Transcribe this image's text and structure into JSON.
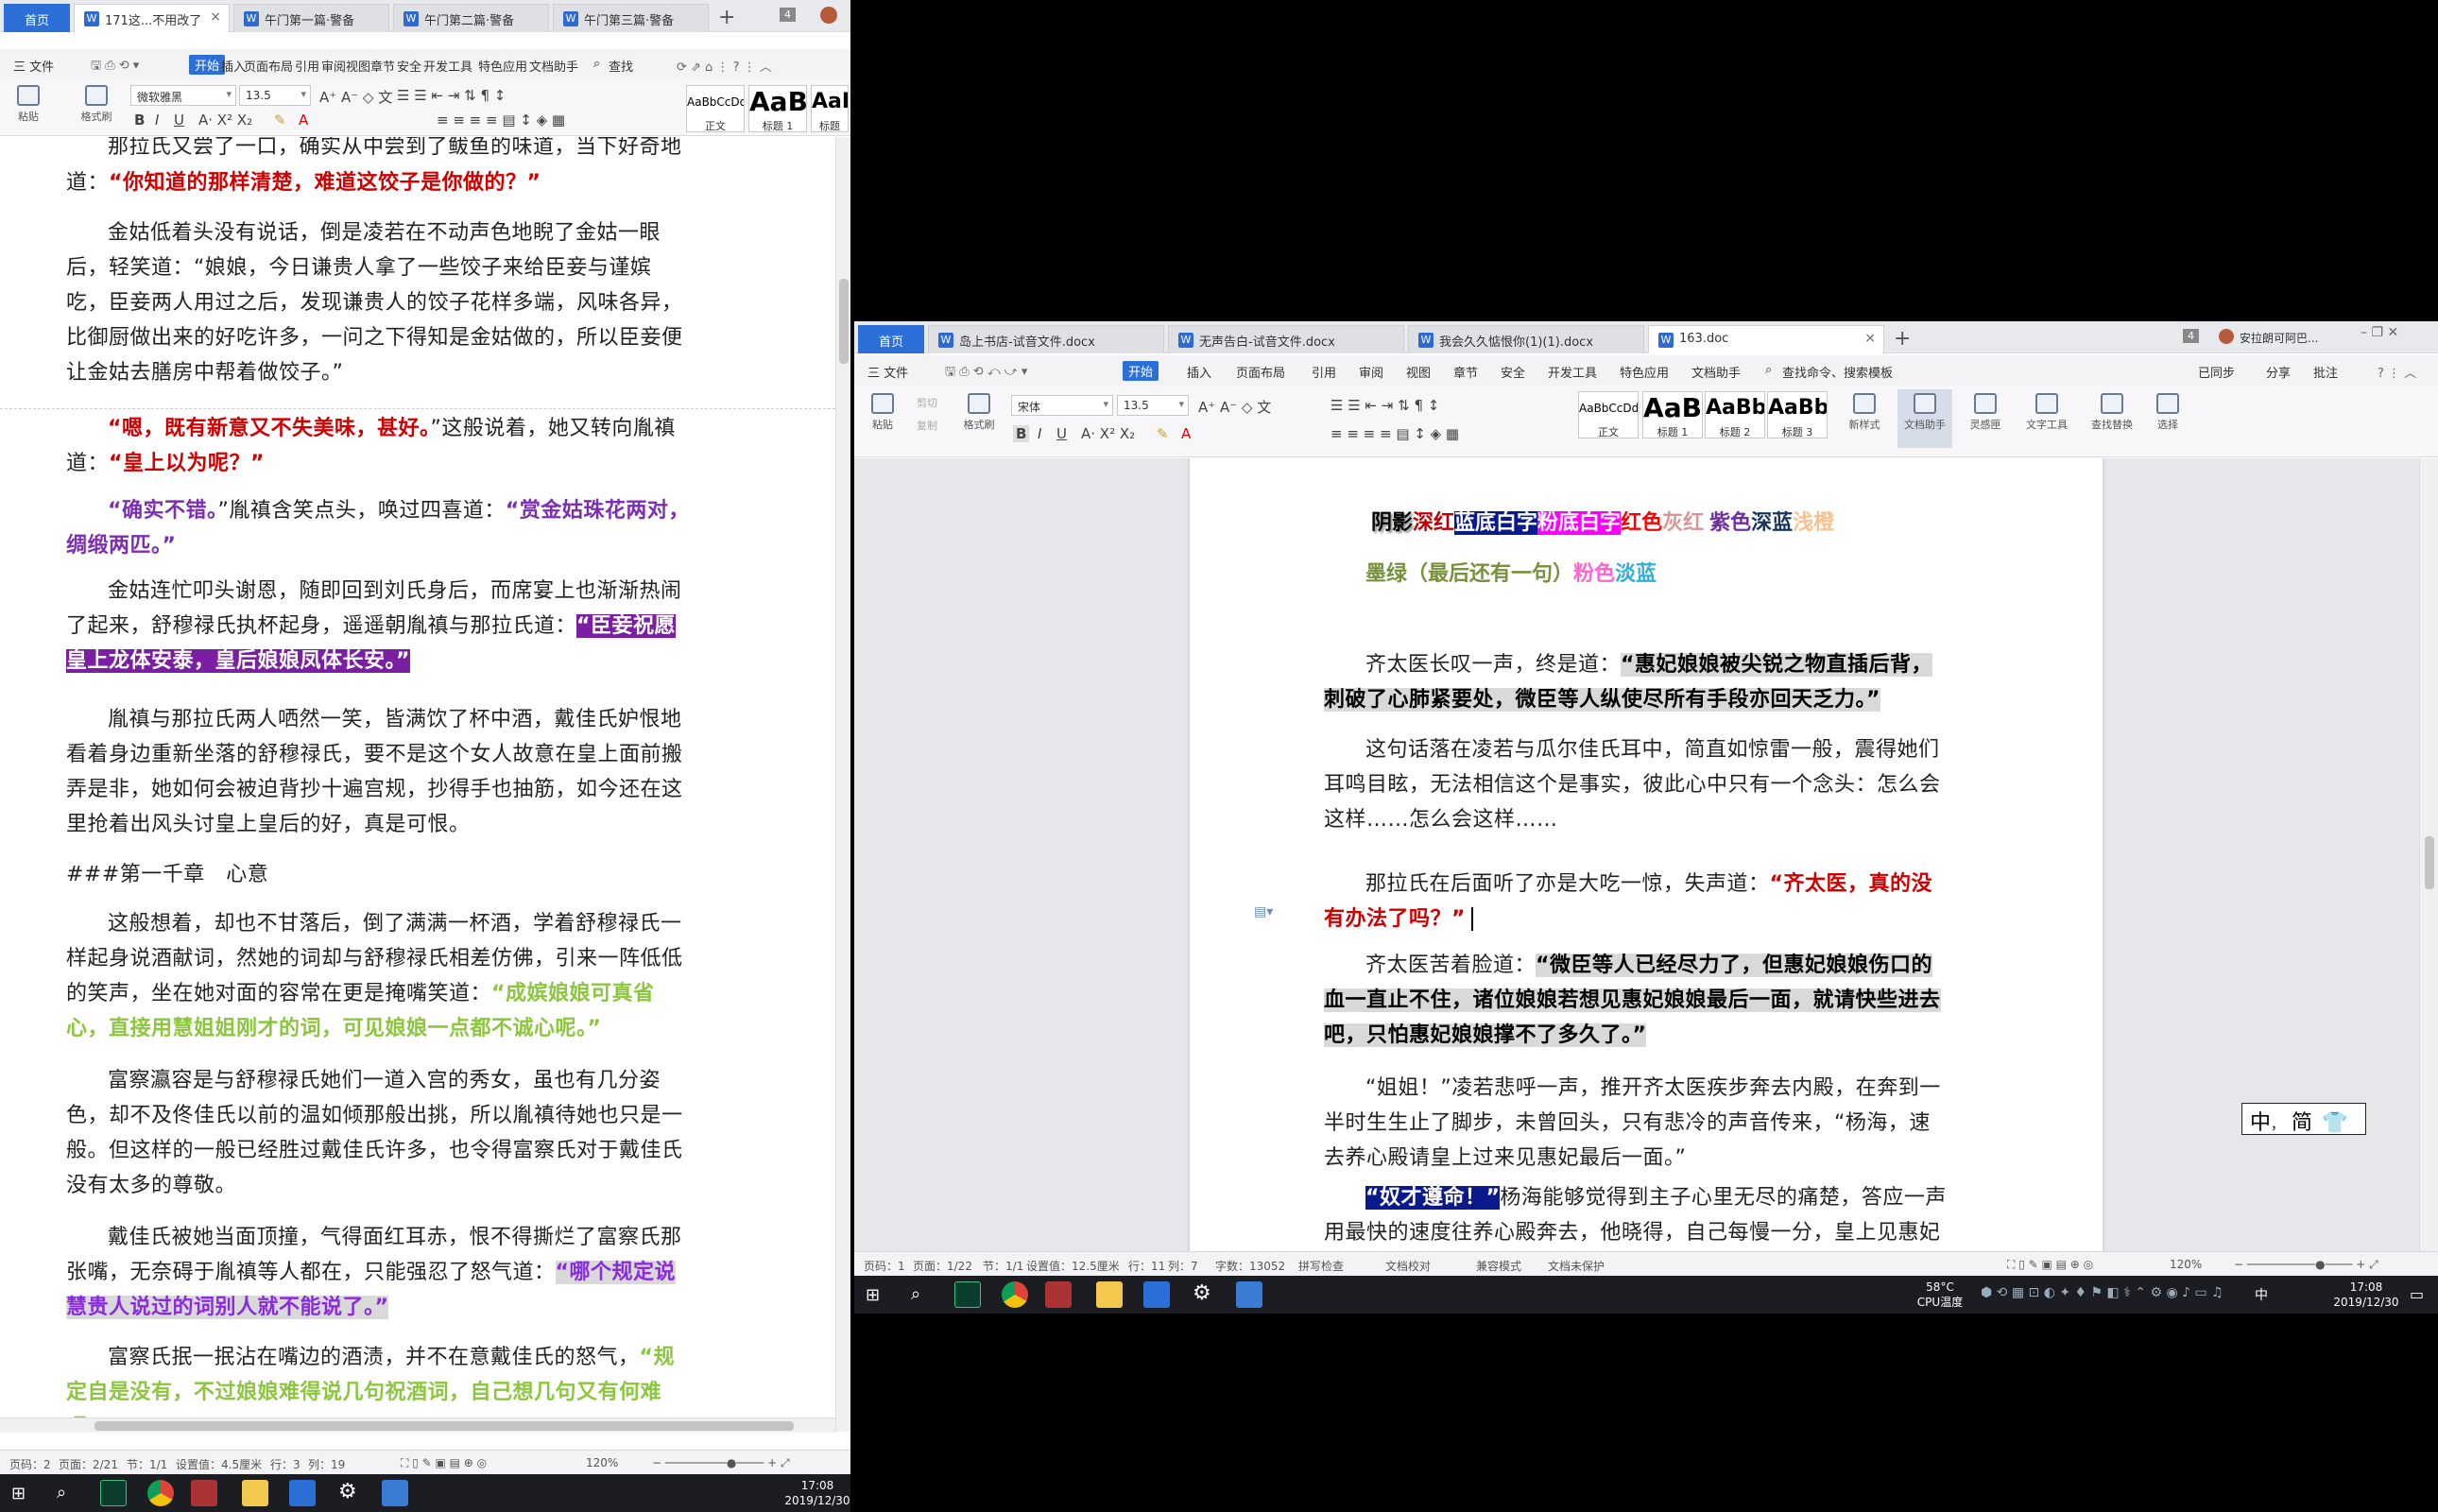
{
  "left_window": {
    "tabs": [
      {
        "label": "首页"
      },
      {
        "label": "171这...不用改了"
      },
      {
        "label": "午门第一篇·警备"
      },
      {
        "label": "午门第二篇·警备"
      },
      {
        "label": "午门第三篇·警备"
      }
    ],
    "tab_badge": "4",
    "menu": {
      "file": "三 文件",
      "items": [
        "开始",
        "插入",
        "页面布局",
        "引用",
        "审阅",
        "视图",
        "章节",
        "安全",
        "开发工具",
        "特色应用",
        "文档助手"
      ],
      "search": "查找"
    },
    "toolbar": {
      "paste": "粘贴",
      "format_painter": "格式刷",
      "font": "微软雅黑",
      "size": "13.5",
      "styles": [
        {
          "big": "AaBbCcDd",
          "label": "正文"
        },
        {
          "big": "AaB",
          "label": "标题 1"
        },
        {
          "big": "AaE",
          "label": "标题"
        }
      ]
    },
    "doc": {
      "p0a": "那拉氏又尝了一口，确实从中尝到了鲅鱼的味道，当下好奇地",
      "p0b_pre": "道：",
      "p0b_red": "“你知道的那样清楚，难道这饺子是你做的？”",
      "p1": "金姑低着头没有说话，倒是凌若在不动声色地睨了金姑一眼后，轻笑道：“娘娘，今日谦贵人拿了一些饺子来给臣妾与谨嫔吃，臣妾两人用过之后，发现谦贵人的饺子花样多端，风味各异，比御厨做出来的好吃许多，一问之下得知是金姑做的，所以臣妾便让金姑去膳房中帮着做饺子。”",
      "p2_red1": "“嗯，既有新意又不失美味，甚好。",
      "p2_mid": "”这般说着，她又转向胤禛道：",
      "p2_red2": "“皇上以为呢？”",
      "p3_purple": "“确实不错。",
      "p3_mid": "”胤禛含笑点头，唤过四喜道：",
      "p3_purple2": "“赏金姑珠花两对，绸缎两匹。”",
      "p4_pre": "金姑连忙叩头谢恩，随即回到刘氏身后，而席宴上也渐渐热闹了起来，舒穆禄氏执杯起身，遥遥朝胤禛与那拉氏道：",
      "p4_hl": "“臣妾祝愿皇上龙体安泰，皇后娘娘凤体长安。”",
      "p5": "胤禛与那拉氏两人哂然一笑，皆满饮了杯中酒，戴佳氏妒恨地看着身边重新坐落的舒穆禄氏，要不是这个女人故意在皇上面前搬弄是非，她如何会被迫背抄十遍宫规，抄得手也抽筋，如今还在这里抢着出风头讨皇上皇后的好，真是可恨。",
      "p6": "###第一千章　心意",
      "p7_pre": "这般想着，却也不甘落后，倒了满满一杯酒，学着舒穆禄氏一样起身说酒献词，然她的词却与舒穆禄氏相差仿佛，引来一阵低低的笑声，坐在她对面的容常在更是掩嘴笑道：",
      "p7_green": "“成嫔娘娘可真省心，直接用慧姐姐刚才的词，可见娘娘一点都不诚心呢。”",
      "p8": "富察瀛容是与舒穆禄氏她们一道入宫的秀女，虽也有几分姿色，却不及佟佳氏以前的温如倾那般出挑，所以胤禛待她也只是一般。但这样的一般已经胜过戴佳氏许多，也令得富察氏对于戴佳氏没有太多的尊敬。",
      "p9_pre": "戴佳氏被她当面顶撞，气得面红耳赤，恨不得撕烂了富察氏那张嘴，无奈碍于胤禛等人都在，只能强忍了怒气道：",
      "p9_hl": "“哪个规定说慧贵人说过的词别人就不能说了。”",
      "p10_pre": "富察氏抿一抿沾在嘴边的酒渍，并不在意戴佳氏的怒气，",
      "p10_green": "“规定自是没有，不过娘娘难得说几句祝酒词，自己想几句又有何难呢。”"
    },
    "status": {
      "page_no": "页码：2",
      "page": "页面：2/21",
      "section": "节：1/1",
      "setting": "设置值：4.5厘米",
      "row": "行：3",
      "col": "列：19",
      "zoom": "120%"
    }
  },
  "left_taskbar": {
    "time": "17:08",
    "date": "2019/12/30"
  },
  "right_window": {
    "tabs": [
      {
        "label": "首页"
      },
      {
        "label": "岛上书店-试音文件.docx"
      },
      {
        "label": "无声告白-试音文件.docx"
      },
      {
        "label": "我会久久惦恨你(1)(1).docx"
      },
      {
        "label": "163.doc"
      }
    ],
    "tab_badge": "4",
    "user": "安拉朗可阿巴...",
    "menu": {
      "file": "三 文件",
      "items": [
        "开始",
        "插入",
        "页面布局",
        "引用",
        "审阅",
        "视图",
        "章节",
        "安全",
        "开发工具",
        "特色应用",
        "文档助手"
      ],
      "search": "查找命令、搜索模板",
      "sync": "已同步",
      "share": "分享",
      "comment": "批注"
    },
    "toolbar": {
      "paste": "粘贴",
      "cut": "剪切",
      "copy": "复制",
      "format_painter": "格式刷",
      "font": "宋体",
      "size": "13.5",
      "styles": [
        {
          "big": "AaBbCcDd",
          "label": "正文"
        },
        {
          "big": "AaB",
          "label": "标题 1"
        },
        {
          "big": "AaBb(",
          "label": "标题 2"
        },
        {
          "big": "AaBb(",
          "label": "标题 3"
        }
      ],
      "new_style": "新样式",
      "doc_assist": "文档助手",
      "ling": "灵感匣",
      "text_tools": "文字工具",
      "find_replace": "查找替换",
      "select": "选择"
    },
    "doc": {
      "legend1": [
        "阴影",
        "深红",
        "蓝底白字",
        "粉底白字",
        "红色",
        "灰红",
        "紫色",
        "深蓝",
        "浅橙"
      ],
      "legend2": [
        "墨绿（最后还有一句）",
        "粉色",
        "淡蓝"
      ],
      "p1_pre": "齐太医长叹一声，终是道：",
      "p1_hl": "“惠妃娘娘被尖锐之物直插后背，刺破了心肺紧要处，微臣等人纵使尽所有手段亦回天乏力。”",
      "p2": "这句话落在凌若与瓜尔佳氏耳中，简直如惊雷一般，震得她们耳鸣目眩，无法相信这个是事实，彼此心中只有一个念头：怎么会这样……怎么会这样……",
      "p3_pre": "那拉氏在后面听了亦是大吃一惊，失声道：",
      "p3_red": "“齐太医，真的没有办法了吗？”",
      "p4_pre": "齐太医苦着脸道：",
      "p4_hl": "“微臣等人已经尽力了，但惠妃娘娘伤口的血一直止不住，诸位娘娘若想见惠妃娘娘最后一面，就请快些进去吧，只怕惠妃娘娘撑不了多久了。”",
      "p5": "“姐姐！”凌若悲呼一声，推开齐太医疾步奔去内殿，在奔到一半时生生止了脚步，未曾回头，只有悲冷的声音传来，“杨海，速去养心殿请皇上过来见惠妃最后一面。”",
      "p6_hl": "“奴才遵命！”",
      "p6_post": "杨海能够觉得到主子心里无尽的痛楚，答应一声用最快的速度往养心殿奔去，他晓得，自己每慢一分，皇上见惠妃最"
    },
    "status": {
      "page_no": "页码：1",
      "page": "页面：1/22",
      "section": "节：1/1",
      "setting": "设置值：12.5厘米",
      "row": "行：11",
      "col": "列：7",
      "words": "字数：13052",
      "spell": "拼写检查",
      "proof": "文档校对",
      "compat": "兼容模式",
      "protect": "文档未保护",
      "zoom": "120%"
    }
  },
  "ime": {
    "mode": "中",
    "simp": "简"
  },
  "right_taskbar": {
    "temp": "58°C",
    "temp_label": "CPU温度",
    "lang": "中",
    "time": "17:08",
    "date": "2019/12/30"
  }
}
